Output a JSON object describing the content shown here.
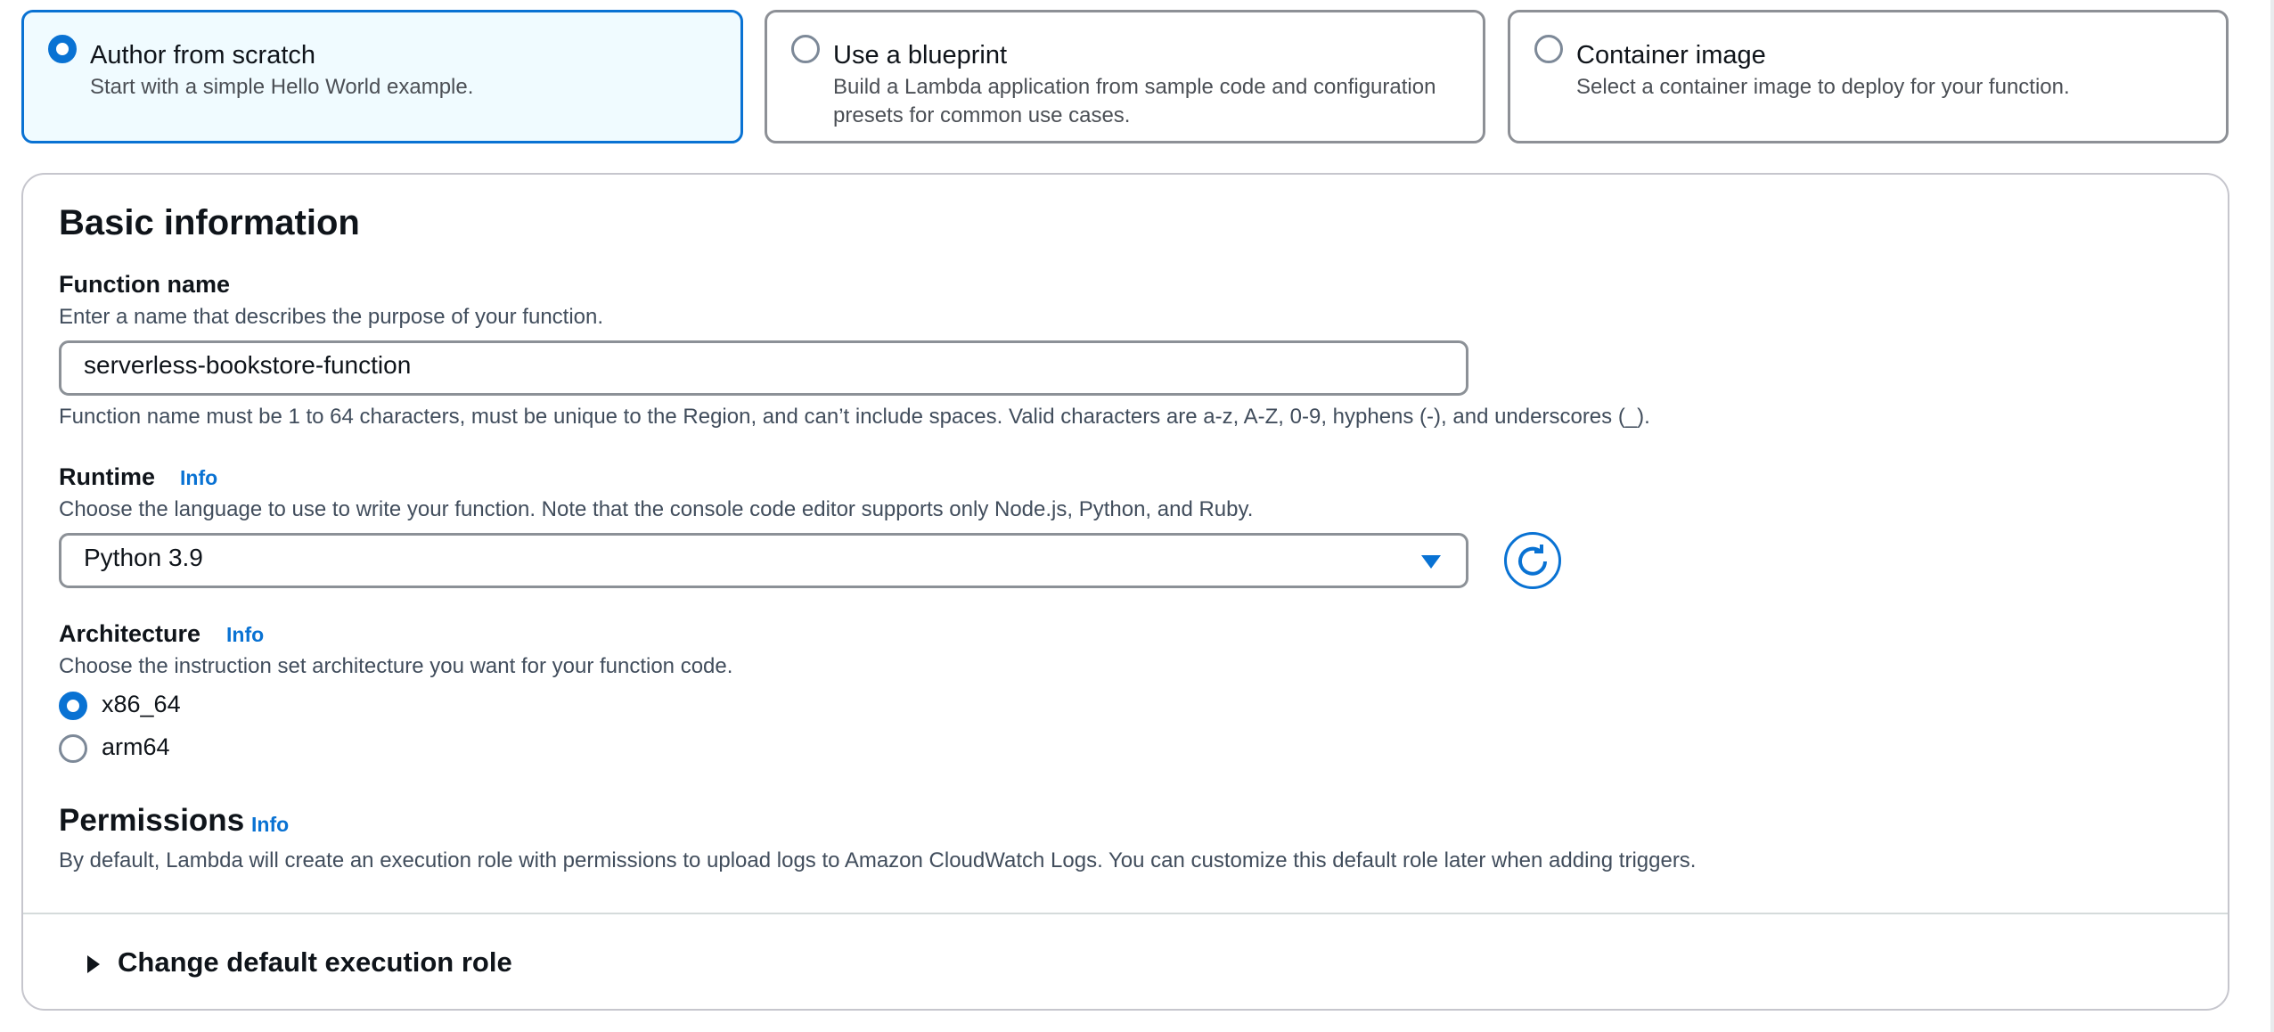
{
  "options": [
    {
      "title": "Author from scratch",
      "description": "Start with a simple Hello World example.",
      "selected": true
    },
    {
      "title": "Use a blueprint",
      "description": "Build a Lambda application from sample code and configuration presets for common use cases.",
      "selected": false
    },
    {
      "title": "Container image",
      "description": "Select a container image to deploy for your function.",
      "selected": false
    }
  ],
  "basic_info": {
    "heading": "Basic information",
    "function_name": {
      "label": "Function name",
      "description": "Enter a name that describes the purpose of your function.",
      "value": "serverless-bookstore-function",
      "constraint": "Function name must be 1 to 64 characters, must be unique to the Region, and can’t include spaces. Valid characters are a-z, A-Z, 0-9, hyphens (-), and underscores (_)."
    },
    "runtime": {
      "label": "Runtime",
      "info": "Info",
      "description": "Choose the language to use to write your function. Note that the console code editor supports only Node.js, Python, and Ruby.",
      "selected": "Python 3.9"
    },
    "architecture": {
      "label": "Architecture",
      "info": "Info",
      "description": "Choose the instruction set architecture you want for your function code.",
      "options": [
        {
          "label": "x86_64",
          "selected": true
        },
        {
          "label": "arm64",
          "selected": false
        }
      ]
    },
    "permissions": {
      "heading": "Permissions",
      "info": "Info",
      "description": "By default, Lambda will create an execution role with permissions to upload logs to Amazon CloudWatch Logs. You can customize this default role later when adding triggers."
    },
    "execution_role": {
      "label": "Change default execution role"
    }
  },
  "colors": {
    "accent": "#0972d3",
    "selected_bg": "#f0fbff",
    "border": "#8d9096"
  },
  "icons": {
    "refresh": "refresh-icon",
    "dropdown": "caret-down-icon",
    "expand": "caret-right-icon"
  }
}
